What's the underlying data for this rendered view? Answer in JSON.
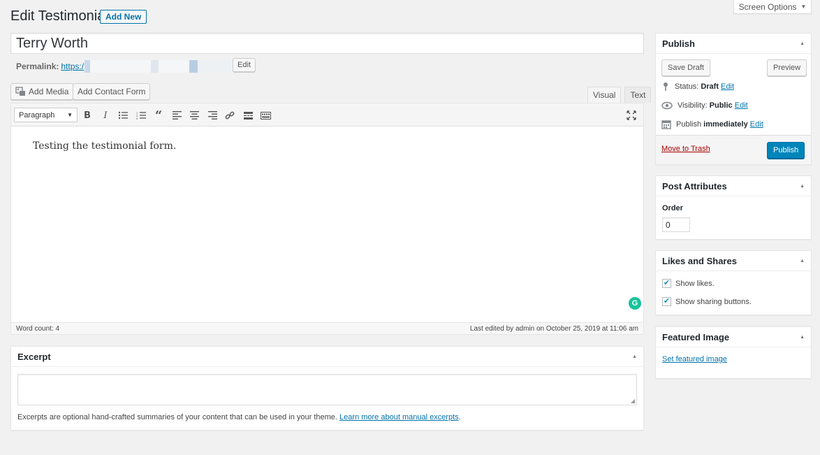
{
  "header": {
    "page_title": "Edit Testimonial",
    "add_new_label": "Add New",
    "screen_options_label": "Screen Options"
  },
  "post": {
    "title": "Terry Worth",
    "permalink_label": "Permalink:",
    "permalink_url": "https:/",
    "permalink_edit_label": "Edit"
  },
  "media_buttons": {
    "add_media": "Add Media",
    "add_contact_form": "Add Contact Form"
  },
  "editor": {
    "tabs": [
      {
        "label": "Visual",
        "active": true
      },
      {
        "label": "Text",
        "active": false
      }
    ],
    "format_select": "Paragraph",
    "toolbar_icons": [
      "bold-icon",
      "italic-icon",
      "bulleted-list-icon",
      "numbered-list-icon",
      "blockquote-icon",
      "align-left-icon",
      "align-center-icon",
      "align-right-icon",
      "link-icon",
      "read-more-icon",
      "toolbar-toggle-icon",
      "fullscreen-icon"
    ],
    "content": "Testing the testimonial form.",
    "word_count": "Word count: 4",
    "last_edited": "Last edited by admin on October 25, 2019 at 11:06 am"
  },
  "excerpt": {
    "title": "Excerpt",
    "value": "",
    "note_text": "Excerpts are optional hand-crafted summaries of your content that can be used in your theme.",
    "note_link": "Learn more about manual excerpts",
    "note_end": "."
  },
  "publish": {
    "title": "Publish",
    "save_draft": "Save Draft",
    "preview": "Preview",
    "status_label": "Status:",
    "status_value": "Draft",
    "visibility_label": "Visibility:",
    "visibility_value": "Public",
    "publish_label": "Publish",
    "publish_value": "immediately",
    "edit_label": "Edit",
    "move_to_trash": "Move to Trash",
    "publish_button": "Publish",
    "accent_color": "#0085ba"
  },
  "post_attributes": {
    "title": "Post Attributes",
    "order_label": "Order",
    "order_value": "0"
  },
  "likes_shares": {
    "title": "Likes and Shares",
    "show_likes": "Show likes.",
    "show_likes_checked": true,
    "show_sharing": "Show sharing buttons.",
    "show_sharing_checked": true
  },
  "featured_image": {
    "title": "Featured Image",
    "set_link": "Set featured image"
  }
}
